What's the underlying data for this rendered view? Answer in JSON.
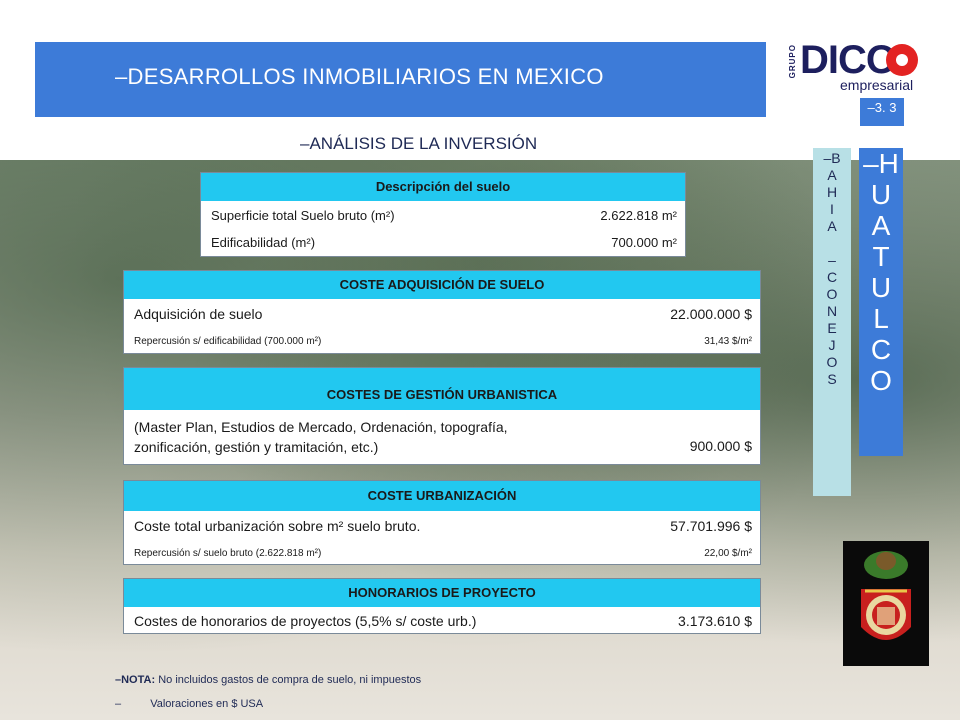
{
  "header": {
    "title": "–DESARROLLOS INMOBILIARIOS EN MEXICO"
  },
  "logo": {
    "grupo": "GRUPO",
    "brand": "DICO",
    "sub": "empresarial"
  },
  "page_number": "–3. 3",
  "subtitle": "–ANÁLISIS DE LA INVERSIÓN",
  "side_bahia": [
    "–B",
    "A",
    "H",
    "I",
    "A",
    "",
    "–",
    "C",
    "O",
    "N",
    "E",
    "J",
    "O",
    "S"
  ],
  "side_huatulco": [
    "–H",
    "U",
    "A",
    "T",
    "U",
    "L",
    "C",
    "O"
  ],
  "suelo": {
    "title": "Descripción del suelo",
    "rows": [
      {
        "label": "Superficie total Suelo bruto (m²)",
        "value": "2.622.818 m²"
      },
      {
        "label": "Edificabilidad (m²)",
        "value": "700.000 m²"
      }
    ]
  },
  "adquisicion": {
    "title": "COSTE ADQUISICIÓN DE SUELO",
    "main": {
      "label": "Adquisición de suelo",
      "value": "22.000.000 $"
    },
    "sub": {
      "label": "Repercusión s/ edificabilidad (700.000 m²)",
      "value": "31,43 $/m²"
    }
  },
  "gestion": {
    "title": "COSTES DE GESTIÓN URBANISTICA",
    "line1": "(Master Plan, Estudios de Mercado, Ordenación, topografía,",
    "line2": "zonificación, gestión y tramitación, etc.)",
    "value": "900.000 $"
  },
  "urbanizacion": {
    "title": "COSTE URBANIZACIÓN",
    "main": {
      "label": "Coste total urbanización sobre m² suelo bruto.",
      "value": "57.701.996 $"
    },
    "sub": {
      "label": "Repercusión s/ suelo bruto (2.622.818 m²)",
      "value": "22,00 $/m²"
    }
  },
  "honorarios": {
    "title": "HONORARIOS  DE PROYECTO",
    "main": {
      "label": "Costes de honorarios de proyectos (5,5% s/ coste urb.)",
      "value": "3.173.610 $"
    }
  },
  "notes": {
    "n1_prefix": "–NOTA:",
    "n1_text": "No incluidos gastos de compra de suelo, ni impuestos",
    "n2_prefix": "–",
    "n2_text": "Valoraciones en $ USA"
  },
  "colors": {
    "header_blue": "#3d7bd8",
    "table_header_cyan": "#22c8f0",
    "logo_red": "#e32322",
    "logo_navy": "#1d1f5e"
  }
}
